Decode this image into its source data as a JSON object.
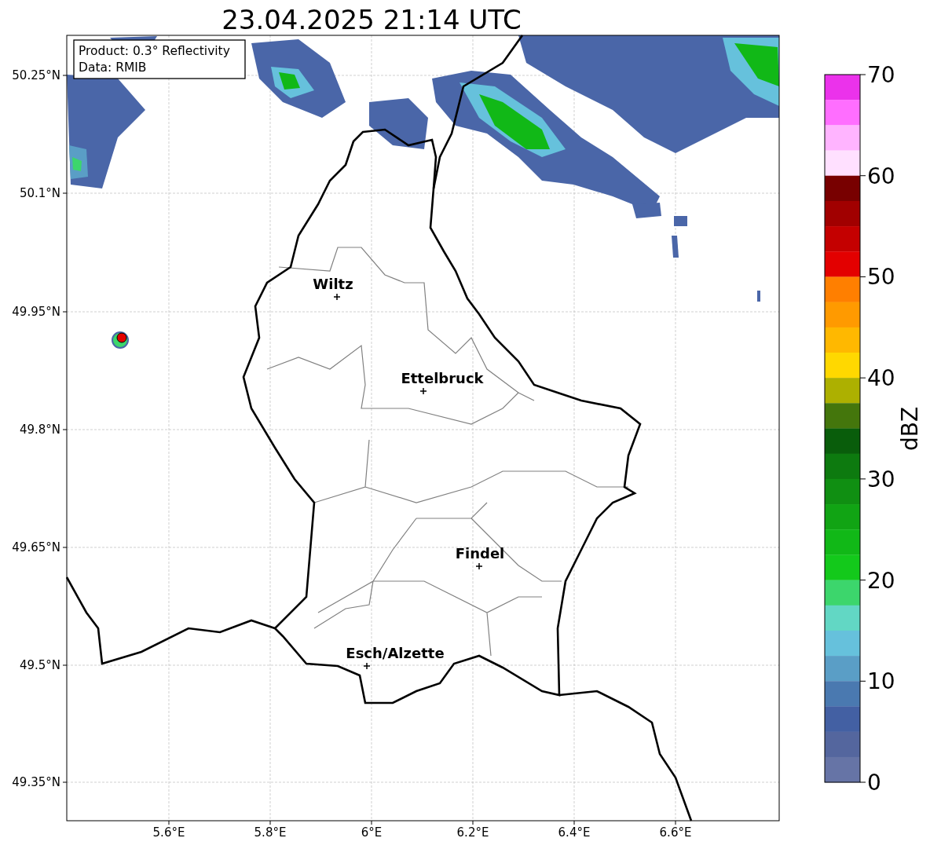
{
  "title": "23.04.2025 21:14 UTC",
  "info_box": [
    "Product: 0.3° Reflectivity",
    "Data: RMIB"
  ],
  "cities": [
    {
      "name": "Wiltz"
    },
    {
      "name": "Ettelbruck"
    },
    {
      "name": "Findel"
    },
    {
      "name": "Esch/Alzette"
    }
  ],
  "x_ticks": [
    "5.6°E",
    "5.8°E",
    "6°E",
    "6.2°E",
    "6.4°E",
    "6.6°E"
  ],
  "y_ticks": [
    "50.25°N",
    "50.1°N",
    "49.95°N",
    "49.8°N",
    "49.65°N",
    "49.5°N",
    "49.35°N"
  ],
  "colorbar": {
    "label": "dBZ",
    "ticks": [
      "70",
      "60",
      "50",
      "40",
      "30",
      "20",
      "10",
      "0"
    ],
    "bins": [
      {
        "color": "#eb32eb"
      },
      {
        "color": "#ff6eff"
      },
      {
        "color": "#ffb4ff"
      },
      {
        "color": "#ffe0ff"
      },
      {
        "color": "#780000"
      },
      {
        "color": "#a10000"
      },
      {
        "color": "#c40000"
      },
      {
        "color": "#e30000"
      },
      {
        "color": "#ff7f00"
      },
      {
        "color": "#ff9a00"
      },
      {
        "color": "#ffb800"
      },
      {
        "color": "#ffd800"
      },
      {
        "color": "#adb000"
      },
      {
        "color": "#44760c"
      },
      {
        "color": "#095d0b"
      },
      {
        "color": "#0d7a0f"
      },
      {
        "color": "#108f12"
      },
      {
        "color": "#11a414"
      },
      {
        "color": "#11b817"
      },
      {
        "color": "#13c91b"
      },
      {
        "color": "#3cd66c"
      },
      {
        "color": "#62d7c4"
      },
      {
        "color": "#66c1dc"
      },
      {
        "color": "#5a9ec6"
      },
      {
        "color": "#4a79b0"
      },
      {
        "color": "#4360a3"
      },
      {
        "color": "#54669e"
      },
      {
        "color": "#6674a6"
      }
    ]
  }
}
